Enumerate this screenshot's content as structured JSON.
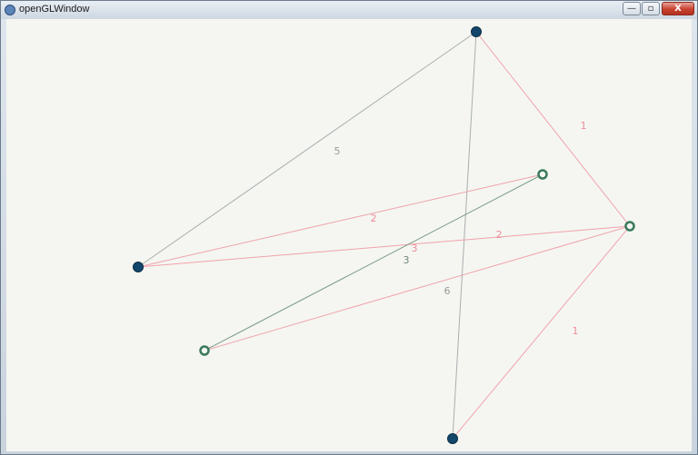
{
  "window": {
    "title": "openGLWindow",
    "controls": {
      "minimize": "—",
      "maximize": "▫",
      "close": "X"
    }
  },
  "colors": {
    "filled_node": "#12466a",
    "ring_node": "#3a7a5c",
    "edge_gray": "#a8aeb0",
    "edge_pink": "#f0a2ad",
    "edge_green": "#7e9e8a",
    "label_gray": "#9a9a9a",
    "label_pink": "#ee8b9a",
    "label_green": "#6f8a7c"
  },
  "graph": {
    "nodes": [
      {
        "id": "n1",
        "style": "filled"
      },
      {
        "id": "n2",
        "style": "filled"
      },
      {
        "id": "n3",
        "style": "ring"
      },
      {
        "id": "n4",
        "style": "ring"
      },
      {
        "id": "n5",
        "style": "ring"
      },
      {
        "id": "n6",
        "style": "filled"
      }
    ],
    "edges": [
      {
        "from": "n1",
        "to": "n2",
        "weight": "5",
        "color": "gray"
      },
      {
        "from": "n1",
        "to": "n6",
        "weight": "6",
        "color": "gray"
      },
      {
        "from": "n1",
        "to": "n5",
        "weight": "1",
        "color": "pink"
      },
      {
        "from": "n6",
        "to": "n5",
        "weight": "1",
        "color": "pink"
      },
      {
        "from": "n2",
        "to": "n3",
        "weight": "2",
        "color": "pink"
      },
      {
        "from": "n2",
        "to": "n5",
        "weight": "2",
        "color": "pink"
      },
      {
        "from": "n3",
        "to": "n4",
        "weight": "3",
        "color": "green"
      },
      {
        "from": "n4",
        "to": "n5",
        "weight": "3",
        "color": "pink"
      }
    ]
  }
}
